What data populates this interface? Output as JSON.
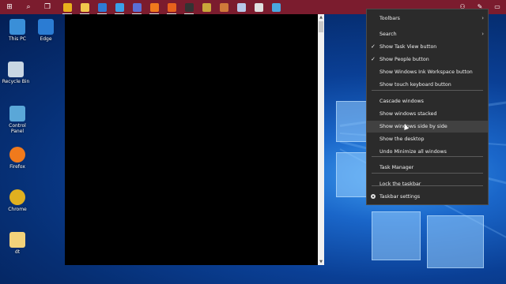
{
  "taskbar": {
    "icons": [
      {
        "name": "start-button",
        "glyph": "⊞"
      },
      {
        "name": "search-icon",
        "glyph": "⌕"
      },
      {
        "name": "task-view-icon",
        "glyph": "❐"
      }
    ],
    "apps": [
      {
        "name": "chrome-taskbar-icon",
        "color": "#e8b11d"
      },
      {
        "name": "file-explorer-taskbar-icon",
        "color": "#f2c94c"
      },
      {
        "name": "edge-taskbar-icon",
        "color": "#2f7bd6"
      },
      {
        "name": "ie-taskbar-icon",
        "color": "#3aa0e8"
      },
      {
        "name": "settings-app-taskbar-icon",
        "color": "#5a6fd6"
      },
      {
        "name": "firefox-taskbar-icon",
        "color": "#f07a1c"
      },
      {
        "name": "firefox-alt-taskbar-icon",
        "color": "#e8621c"
      },
      {
        "name": "terminal-taskbar-icon",
        "color": "#333333"
      },
      {
        "name": "tool-taskbar-icon",
        "color": "#c9a73a"
      },
      {
        "name": "paint-taskbar-icon",
        "color": "#d07a3a"
      },
      {
        "name": "app-taskbar-icon",
        "color": "#b8c8e8"
      },
      {
        "name": "dot-taskbar-icon",
        "color": "#e0e0e0"
      },
      {
        "name": "graph-app-taskbar-icon",
        "color": "#4aa8e0"
      }
    ],
    "tray": [
      {
        "name": "people-icon",
        "glyph": "⚇"
      },
      {
        "name": "ink-workspace-icon",
        "glyph": "✎"
      },
      {
        "name": "notification-icon",
        "glyph": "▭"
      }
    ]
  },
  "desktop_icons": [
    {
      "name": "this-pc",
      "label": "This PC",
      "color": "#3a8fd8"
    },
    {
      "name": "edge",
      "label": "Edge",
      "color": "#2b7cd3"
    },
    {
      "name": "recycle-bin",
      "label": "Recycle Bin",
      "color": "#c9d6e3"
    },
    {
      "name": "control-panel",
      "label": "Control Panel",
      "color": "#5aa7d8"
    },
    {
      "name": "firefox",
      "label": "Firefox",
      "color": "#f07a1c"
    },
    {
      "name": "chrome",
      "label": "Chrome",
      "color": "#e0b020"
    },
    {
      "name": "dt",
      "label": "dt",
      "color": "#f2d27a"
    }
  ],
  "context_menu": {
    "items": [
      {
        "label": "Toolbars",
        "checked": false,
        "submenu": true
      },
      {
        "label": "Search",
        "checked": false,
        "submenu": true
      },
      {
        "label": "Show Task View button",
        "checked": true,
        "submenu": false
      },
      {
        "label": "Show People button",
        "checked": true,
        "submenu": false
      },
      {
        "label": "Show Windows Ink Workspace button",
        "checked": false,
        "submenu": false
      },
      {
        "label": "Show touch keyboard button",
        "checked": false,
        "submenu": false
      },
      {
        "label": "Cascade windows",
        "checked": false,
        "submenu": false
      },
      {
        "label": "Show windows stacked",
        "checked": false,
        "submenu": false
      },
      {
        "label": "Show windows side by side",
        "checked": false,
        "submenu": false,
        "highlighted": true
      },
      {
        "label": "Show the desktop",
        "checked": false,
        "submenu": false
      },
      {
        "label": "Undo Minimize all windows",
        "checked": false,
        "submenu": false
      },
      {
        "label": "Task Manager",
        "checked": false,
        "submenu": false
      },
      {
        "label": "Lock the taskbar",
        "checked": false,
        "submenu": false
      },
      {
        "label": "Taskbar settings",
        "checked": false,
        "submenu": false,
        "gear": true
      }
    ],
    "check_glyph": "✓",
    "arrow_glyph": "›"
  },
  "colors": {
    "taskbar": "#7b1c2e",
    "menu_bg": "#2b2b2b",
    "menu_highlight": "#414141"
  }
}
